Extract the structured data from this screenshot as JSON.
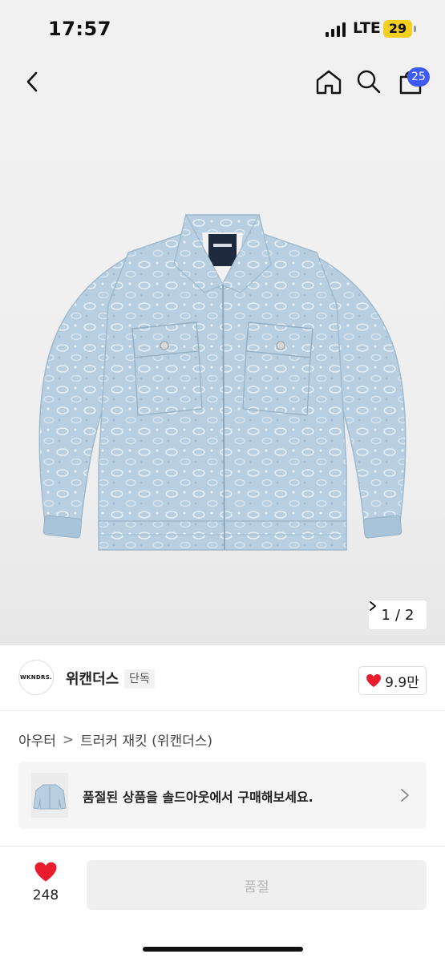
{
  "status_bar": {
    "time": "17:57",
    "network": "LTE",
    "battery": "29"
  },
  "nav": {
    "back_icon": "chevron-left-icon",
    "home_icon": "home-icon",
    "search_icon": "search-icon",
    "bag_icon": "shopping-bag-icon",
    "cart_count": "25",
    "badge_color": "#3d5af1"
  },
  "gallery": {
    "page_current": "1",
    "page_separator": "/",
    "page_total": "2",
    "next_icon": "chevron-right-icon"
  },
  "brand": {
    "logo_text": "WKNDRS.",
    "name": "위캔더스",
    "tag": "단독",
    "like_count": "9.9만",
    "heart_color": "#e81c2d"
  },
  "breadcrumb": {
    "category": "아우터",
    "separator": ">",
    "product": "트러커 재킷 (위캔더스)"
  },
  "soldout_banner": {
    "message": "품절된 상품을 솔드아웃에서 구매해보세요."
  },
  "bottom_bar": {
    "wish_count": "248",
    "action_label": "품절"
  }
}
